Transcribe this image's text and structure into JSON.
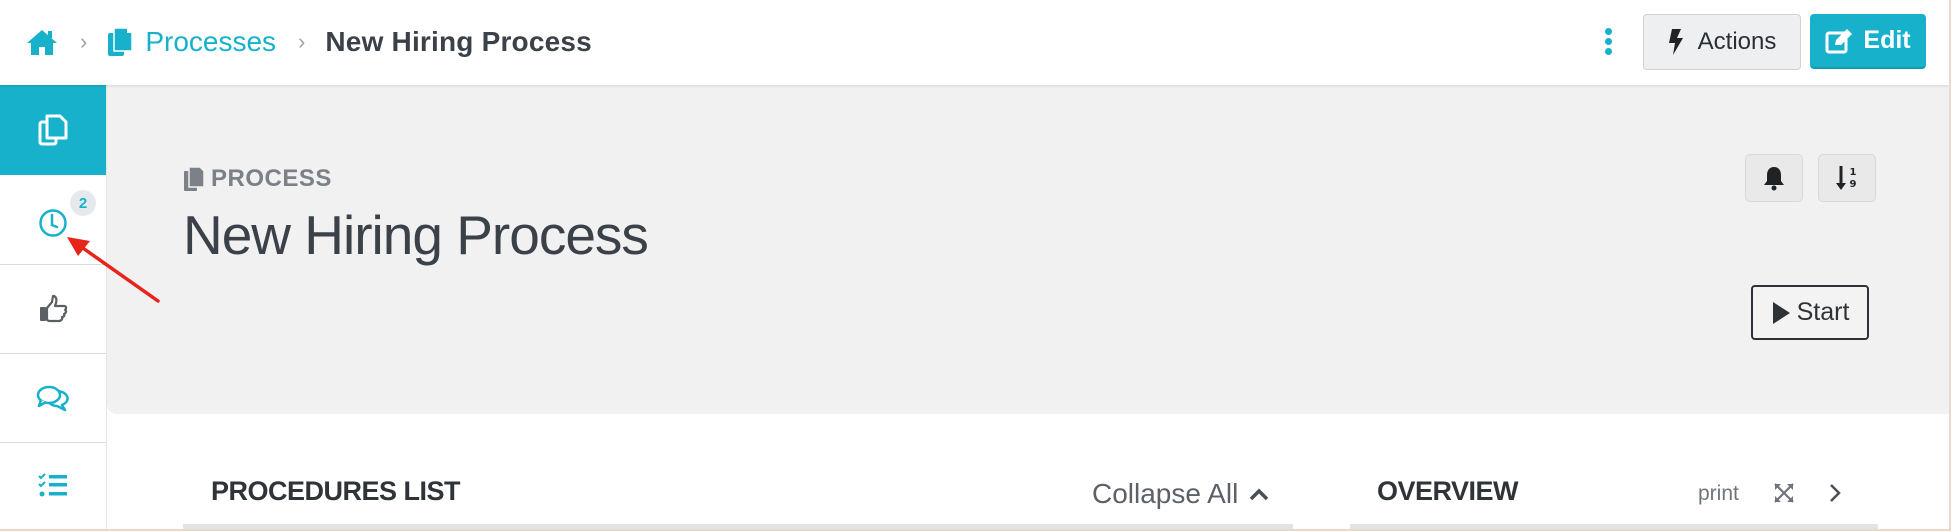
{
  "header": {
    "breadcrumb": [
      {
        "label": "",
        "icon": "home-icon"
      },
      {
        "label": "Processes",
        "icon": "copy-icon"
      },
      {
        "label": "New Hiring Process"
      }
    ],
    "actions_label": "Actions",
    "edit_label": "Edit"
  },
  "sidebar": {
    "items": [
      {
        "name": "documents",
        "icon": "copy-icon",
        "active": true
      },
      {
        "name": "history",
        "icon": "clock-icon",
        "badge": "2"
      },
      {
        "name": "likes",
        "icon": "thumbs-up-icon"
      },
      {
        "name": "comments",
        "icon": "comments-icon"
      },
      {
        "name": "checklist",
        "icon": "list-check-icon"
      }
    ]
  },
  "banner": {
    "eyebrow": "PROCESS",
    "title": "New Hiring Process",
    "start_label": "Start"
  },
  "procedures": {
    "title": "PROCEDURES LIST",
    "collapse_label": "Collapse All"
  },
  "overview": {
    "title": "OVERVIEW",
    "print_label": "print"
  },
  "colors": {
    "accent": "#17b1cc",
    "banner_bg": "#f1f1f2",
    "annotation_arrow": "#e8231a"
  }
}
